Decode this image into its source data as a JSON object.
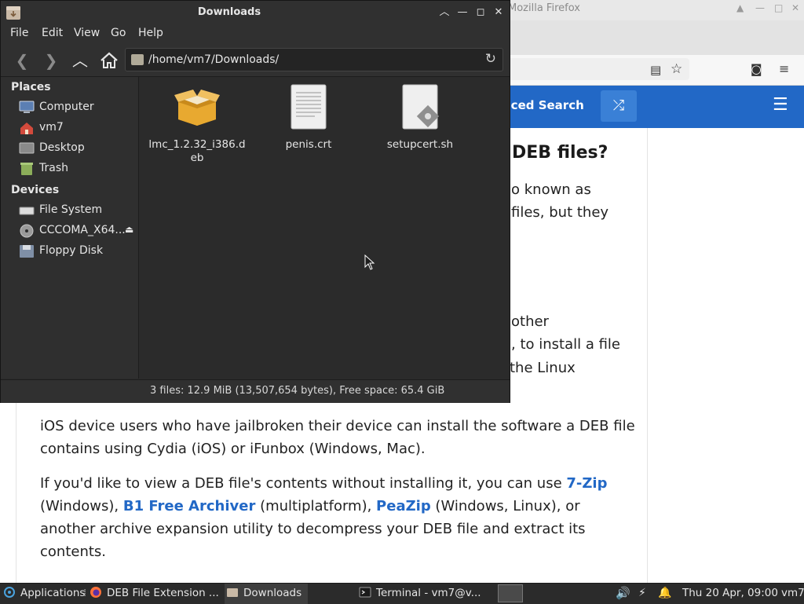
{
  "firefox": {
    "window_title": "Mozilla Firefox",
    "search_button": "nced Search",
    "heading": "DEB files?",
    "partial_lines": [
      {
        "text": "o known as"
      },
      {
        "text": "files, but they"
      },
      {
        "text": "other"
      },
      {
        "text": ", to install a file"
      },
      {
        "text": "the Linux"
      }
    ],
    "para1": "iOS device users who have jailbroken their device can install the software a DEB file contains using Cydia (iOS) or iFunbox (Windows, Mac).",
    "para2": {
      "t1": "If you'd like to view a DEB file's contents without installing it, you can use ",
      "link1": "7-Zip",
      "t2": " (Windows), ",
      "link2": "B1 Free Archiver",
      "t3": " (multiplatform), ",
      "link3": "PeaZip",
      "t4": " (Windows, Linux), or another archive expansion utility to decompress your DEB file and extract its contents."
    }
  },
  "file_manager": {
    "title": "Downloads",
    "menu": [
      "File",
      "Edit",
      "View",
      "Go",
      "Help"
    ],
    "path": "/home/vm7/Downloads/",
    "sidebar": {
      "places_label": "Places",
      "places": [
        "Computer",
        "vm7",
        "Desktop",
        "Trash"
      ],
      "devices_label": "Devices",
      "devices": [
        "File System",
        "CCCOMA_X64...",
        "Floppy Disk"
      ]
    },
    "files": [
      {
        "name": "lmc_1.2.32_i386.deb",
        "icon": "package-icon"
      },
      {
        "name": "penis.crt",
        "icon": "text-file-icon"
      },
      {
        "name": "setupcert.sh",
        "icon": "script-file-icon"
      }
    ],
    "status": "3 files: 12.9 MiB (13,507,654 bytes), Free space: 65.4 GiB"
  },
  "taskbar": {
    "applications": "Applications",
    "tasks": [
      "DEB File Extension ...",
      "Downloads",
      "Terminal - vm7@v..."
    ],
    "clock": "Thu 20 Apr, 09:00",
    "user": "vm7"
  },
  "colors": {
    "site_header": "#2268c6",
    "link": "#2268c6",
    "fm_background": "#2b2b2b"
  }
}
